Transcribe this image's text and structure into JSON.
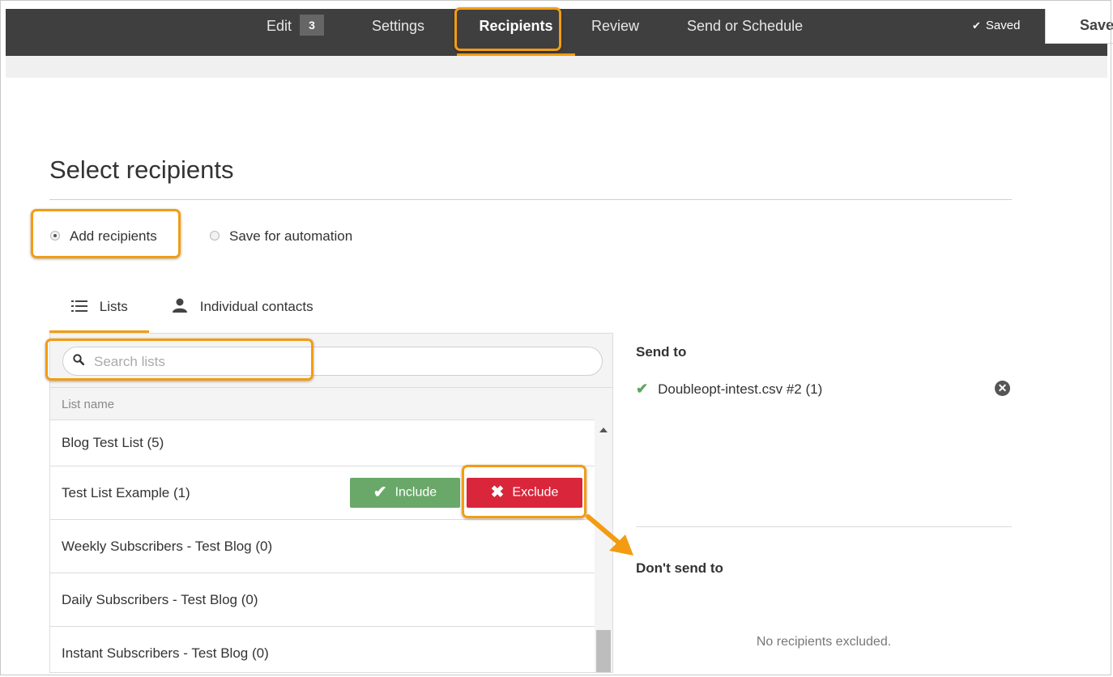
{
  "topnav": {
    "tabs": {
      "edit": {
        "label": "Edit",
        "count": "3"
      },
      "settings": {
        "label": "Settings"
      },
      "recipients": {
        "label": "Recipients"
      },
      "review": {
        "label": "Review"
      },
      "send": {
        "label": "Send or Schedule"
      }
    },
    "saved_status": "Saved",
    "save_button": "Save"
  },
  "page": {
    "title": "Select recipients",
    "mode_options": {
      "add": "Add recipients",
      "automation": "Save for automation"
    },
    "selected_mode": "add"
  },
  "subtabs": {
    "lists": "Lists",
    "contacts": "Individual contacts"
  },
  "list_panel": {
    "search_placeholder": "Search lists",
    "column_header": "List name",
    "rows": [
      {
        "name": "Blog Test List (5)"
      },
      {
        "name": "Test List Example (1)"
      },
      {
        "name": "Weekly Subscribers - Test Blog (0)"
      },
      {
        "name": "Daily Subscribers - Test Blog (0)"
      },
      {
        "name": "Instant Subscribers - Test Blog (0)"
      }
    ],
    "include_label": "Include",
    "exclude_label": "Exclude"
  },
  "send_to": {
    "title": "Send to",
    "items": [
      {
        "name": "Doubleopt-intest.csv #2 (1)"
      }
    ]
  },
  "dont_send_to": {
    "title": "Don't send to",
    "empty_message": "No recipients excluded."
  },
  "colors": {
    "nav_bg": "#3f3f3f",
    "accent": "#f39c12",
    "include": "#6aa86a",
    "exclude": "#d9263a"
  }
}
